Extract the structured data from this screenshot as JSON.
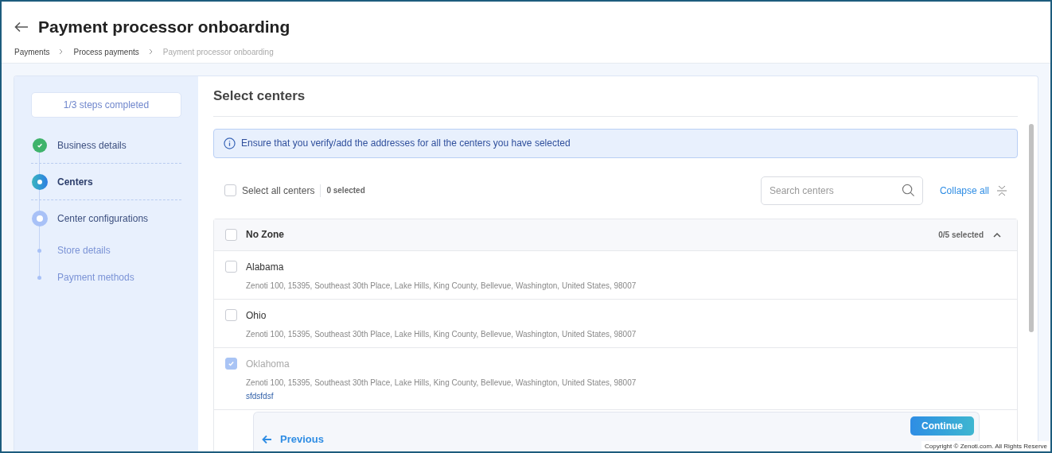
{
  "header": {
    "title": "Payment processor onboarding",
    "breadcrumb": [
      {
        "label": "Payments",
        "current": false
      },
      {
        "label": "Process payments",
        "current": false
      },
      {
        "label": "Payment processor onboarding",
        "current": true
      }
    ]
  },
  "sidebar": {
    "progress": "1/3 steps completed",
    "steps": [
      {
        "label": "Business details",
        "completed": true,
        "current": false
      },
      {
        "label": "Centers",
        "completed": false,
        "current": true
      },
      {
        "label": "Center configurations",
        "completed": false,
        "current": false,
        "children": [
          {
            "label": "Store details"
          },
          {
            "label": "Payment methods"
          }
        ]
      }
    ]
  },
  "main": {
    "title": "Select centers",
    "notice": "Ensure that you verify/add the addresses for all the centers you have selected",
    "select_all": {
      "label": "Select all centers",
      "checked": false,
      "count": "0 selected"
    },
    "search": {
      "placeholder": "Search centers"
    },
    "collapse_all": "Collapse all",
    "group": {
      "name": "No Zone",
      "checked": false,
      "count": "0/5 selected",
      "expanded": true,
      "centers": [
        {
          "name": "Alabama",
          "address": "Zenoti 100, 15395, Southeast 30th Place, Lake Hills, King County, Bellevue, Washington, United States, 98007",
          "checked": false,
          "disabled": false
        },
        {
          "name": "Ohio",
          "address": "Zenoti 100, 15395, Southeast 30th Place, Lake Hills, King County, Bellevue, Washington, United States, 98007",
          "checked": false,
          "disabled": false
        },
        {
          "name": "Oklahoma",
          "address": "Zenoti 100, 15395, Southeast 30th Place, Lake Hills, King County, Bellevue, Washington, United States, 98007",
          "checked": true,
          "disabled": true,
          "note": "sfdsfdsf"
        }
      ]
    }
  },
  "footer": {
    "previous": "Previous",
    "continue": "Continue"
  },
  "copyright": "Copyright © Zenoti.com. All Rights Reserve"
}
